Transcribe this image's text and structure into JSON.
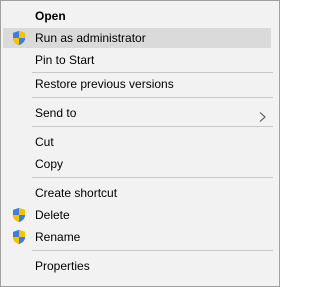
{
  "context_menu": {
    "items": [
      {
        "label": "Open",
        "bold": true
      },
      {
        "label": "Run as administrator",
        "icon": "uac-shield-icon",
        "highlighted": true
      },
      {
        "label": "Pin to Start"
      },
      {
        "label": "Restore previous versions"
      },
      {
        "label": "Send to",
        "submenu": true
      },
      {
        "label": "Cut"
      },
      {
        "label": "Copy"
      },
      {
        "label": "Create shortcut"
      },
      {
        "label": "Delete",
        "icon": "uac-shield-icon"
      },
      {
        "label": "Rename",
        "icon": "uac-shield-icon"
      },
      {
        "label": "Properties"
      }
    ]
  }
}
